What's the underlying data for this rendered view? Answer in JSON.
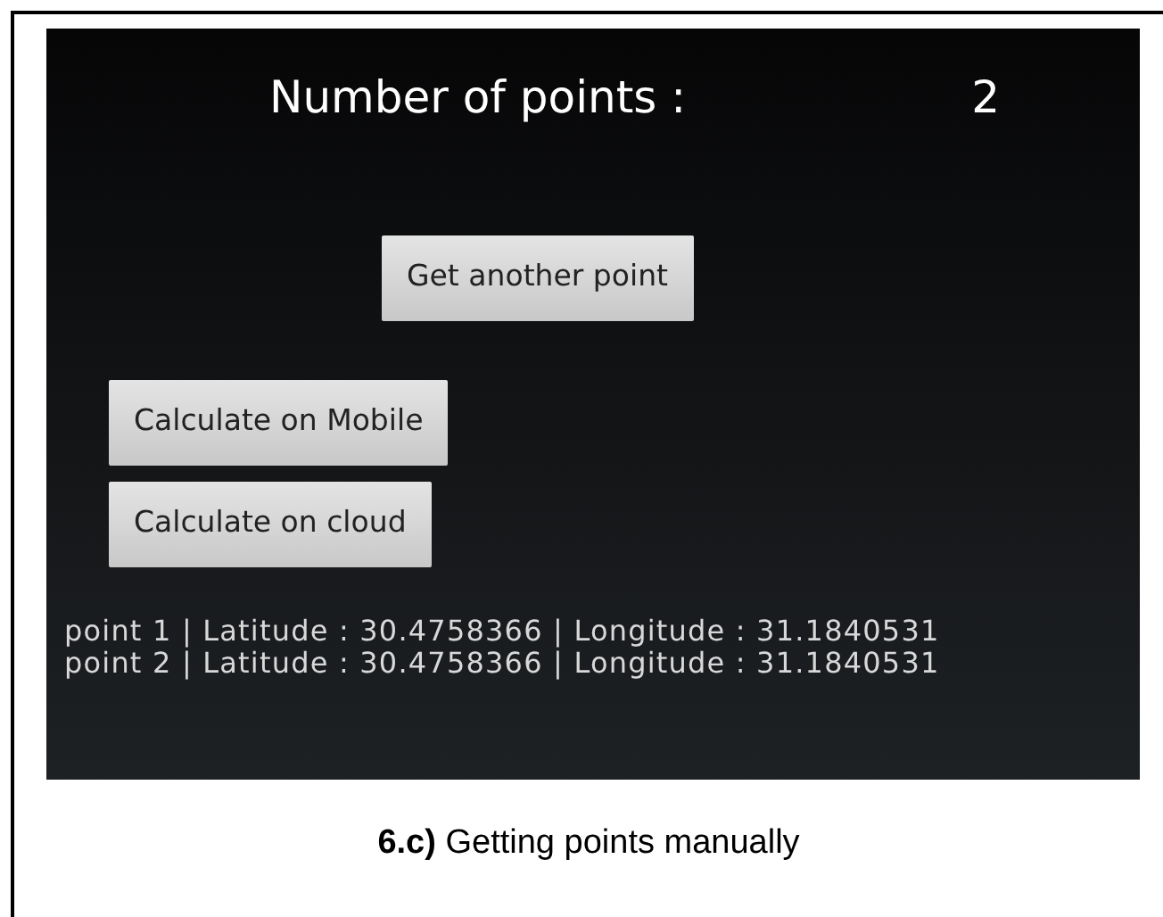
{
  "screen": {
    "count_label": "Number of points :",
    "count_value": "2",
    "buttons": [
      {
        "label": "Get another point",
        "kind": "center"
      },
      {
        "label": "Calculate on Mobile",
        "kind": "left"
      },
      {
        "label": "Calculate on cloud",
        "kind": "left"
      }
    ],
    "points": [
      "point 1 | Latitude : 30.4758366 | Longitude : 31.1840531",
      "point 2 | Latitude : 30.4758366 | Longitude : 31.1840531"
    ]
  },
  "caption": "**6.c)** Getting points manually"
}
